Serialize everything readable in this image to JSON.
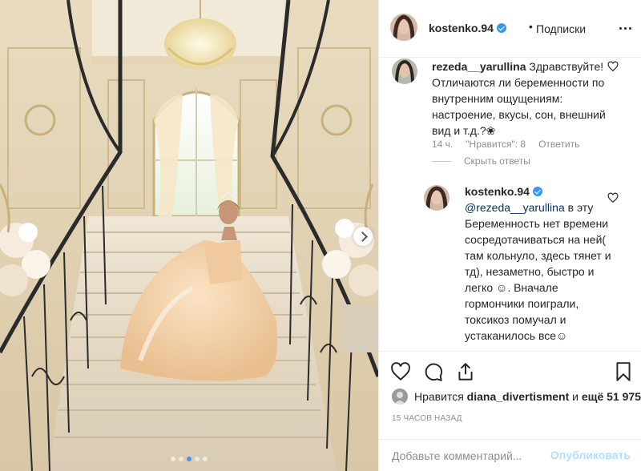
{
  "photo": {
    "description_icon": "staircase-bride-photo",
    "carousel": {
      "count": 5,
      "active": 2
    }
  },
  "header": {
    "username": "kostenko.94",
    "separator": "•",
    "follow_label": "Подписки",
    "verified": true
  },
  "comments": [
    {
      "username": "rezeda__yarullina",
      "text": "Здравствуйте! Отличаются ли беременности по внутренним ощущениям: настроение, вкусы, сон, внешний вид и т.д.?❀",
      "time": "14 ч.",
      "likes": "\"Нравится\": 8",
      "reply_label": "Ответить",
      "hide_replies_label": "Скрыть ответы"
    },
    {
      "username": "kostenko.94",
      "mention": "@rezeda__yarullina",
      "text": " в эту Беременность нет времени сосредотачиваться на ней( там кольнуло, здесь тянет и тд), незаметно, быстро и легко ☺. Вначале гормончики поиграли, токсикоз помучал и устаканилось все☺"
    }
  ],
  "actions": {
    "likes_prefix": "Нравится",
    "likes_user": "diana_divertisment",
    "likes_middle": "и",
    "likes_count": "ещё 51 975",
    "timestamp": "15 ЧАСОВ НАЗАД"
  },
  "comment_box": {
    "placeholder": "Добавьте комментарий...",
    "publish_label": "Опубликовать"
  },
  "colors": {
    "accent": "#3897f0",
    "publish_disabled": "#b2dffc",
    "meta_gray": "#8e8e8e"
  }
}
